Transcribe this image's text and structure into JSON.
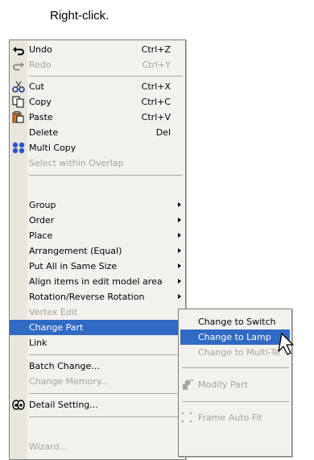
{
  "caption": "Right-click.",
  "menu": {
    "undo": {
      "label": "Undo",
      "shortcut": "Ctrl+Z",
      "icon": "undo-icon"
    },
    "redo": {
      "label": "Redo",
      "shortcut": "Ctrl+Y",
      "icon": "redo-icon"
    },
    "cut": {
      "label": "Cut",
      "shortcut": "Ctrl+X",
      "icon": "scissors-icon"
    },
    "copy": {
      "label": "Copy",
      "shortcut": "Ctrl+C",
      "icon": "copy-icon"
    },
    "paste": {
      "label": "Paste",
      "shortcut": "Ctrl+V",
      "icon": "paste-icon"
    },
    "delete": {
      "label": "Delete",
      "shortcut": "Del"
    },
    "multi_copy": {
      "label": "Multi Copy",
      "icon": "multi-copy-icon"
    },
    "select_within_overlap": {
      "label": "Select within Overlap"
    },
    "group": {
      "label": "Group"
    },
    "order": {
      "label": "Order"
    },
    "place": {
      "label": "Place"
    },
    "arrangement": {
      "label": "Arrangement (Equal)"
    },
    "same_size": {
      "label": "Put All in Same Size"
    },
    "align_items": {
      "label": "Align items in edit model area"
    },
    "rotation": {
      "label": "Rotation/Reverse Rotation"
    },
    "vertex_edit": {
      "label": "Vertex Edit"
    },
    "change_part": {
      "label": "Change Part"
    },
    "link": {
      "label": "Link"
    },
    "batch_change": {
      "label": "Batch Change..."
    },
    "change_memory": {
      "label": "Change Memory..."
    },
    "detail_setting": {
      "label": "Detail Setting...",
      "icon": "detail-setting-icon"
    },
    "wizard": {
      "label": "Wizard..."
    }
  },
  "submenu": {
    "change_to_switch": {
      "label": "Change to Switch"
    },
    "change_to_lamp": {
      "label": "Change to Lamp"
    },
    "change_to_multi_text": {
      "label": "Change to Multi-Te"
    },
    "modify_part": {
      "label": "Modify Part",
      "icon": "modify-part-icon"
    },
    "frame_auto_fit": {
      "label": "Frame Auto Fit",
      "icon": "frame-auto-fit-icon"
    }
  },
  "colors": {
    "highlight": "#316ac5",
    "menu_bg": "#f3f1ed",
    "disabled": "#a6a39c"
  }
}
